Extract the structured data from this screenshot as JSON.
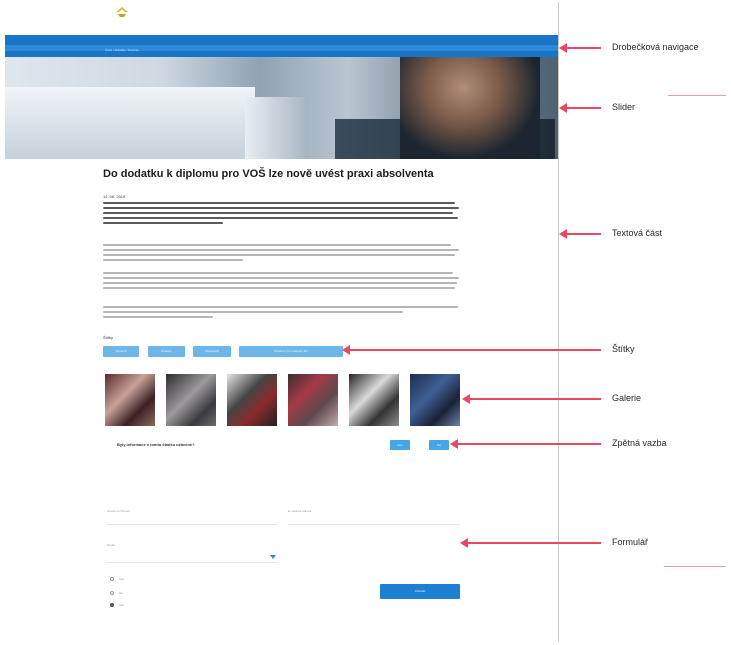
{
  "page": {
    "breadcrumb": "Úvod / Aktuality / Novinky",
    "title": "Do dodatku k diplomu pro VOŠ lze nově uvést praxi absolventa",
    "date": "12. 06. 2019",
    "tags_label": "Štítky",
    "tags": [
      "Studenti",
      "Praktiky",
      "Absolventi",
      "Prostory pro studenty EU"
    ],
    "feedback_question": "Byly informace v tomto článku užitečné?",
    "feedback_yes": "Ano",
    "feedback_no": "Ne",
    "form": {
      "field1_label": "Jméno a příjmení",
      "field2_label": "E-mailová adresa",
      "select_label": "Zvolte",
      "radio1": "Ano",
      "radio2": "Ne",
      "radio3": "Ano",
      "submit_label": "Odeslat"
    }
  },
  "annotations": [
    "Drobečková navigace",
    "Slider",
    "Textová část",
    "Štítky",
    "Galerie",
    "Zpětná vazba",
    "Formulář"
  ],
  "colors": {
    "nav_blue": "#1976c7",
    "tag_blue": "#6db6ea",
    "button_blue": "#1e80d2",
    "arrow_red": "#e64a63"
  }
}
